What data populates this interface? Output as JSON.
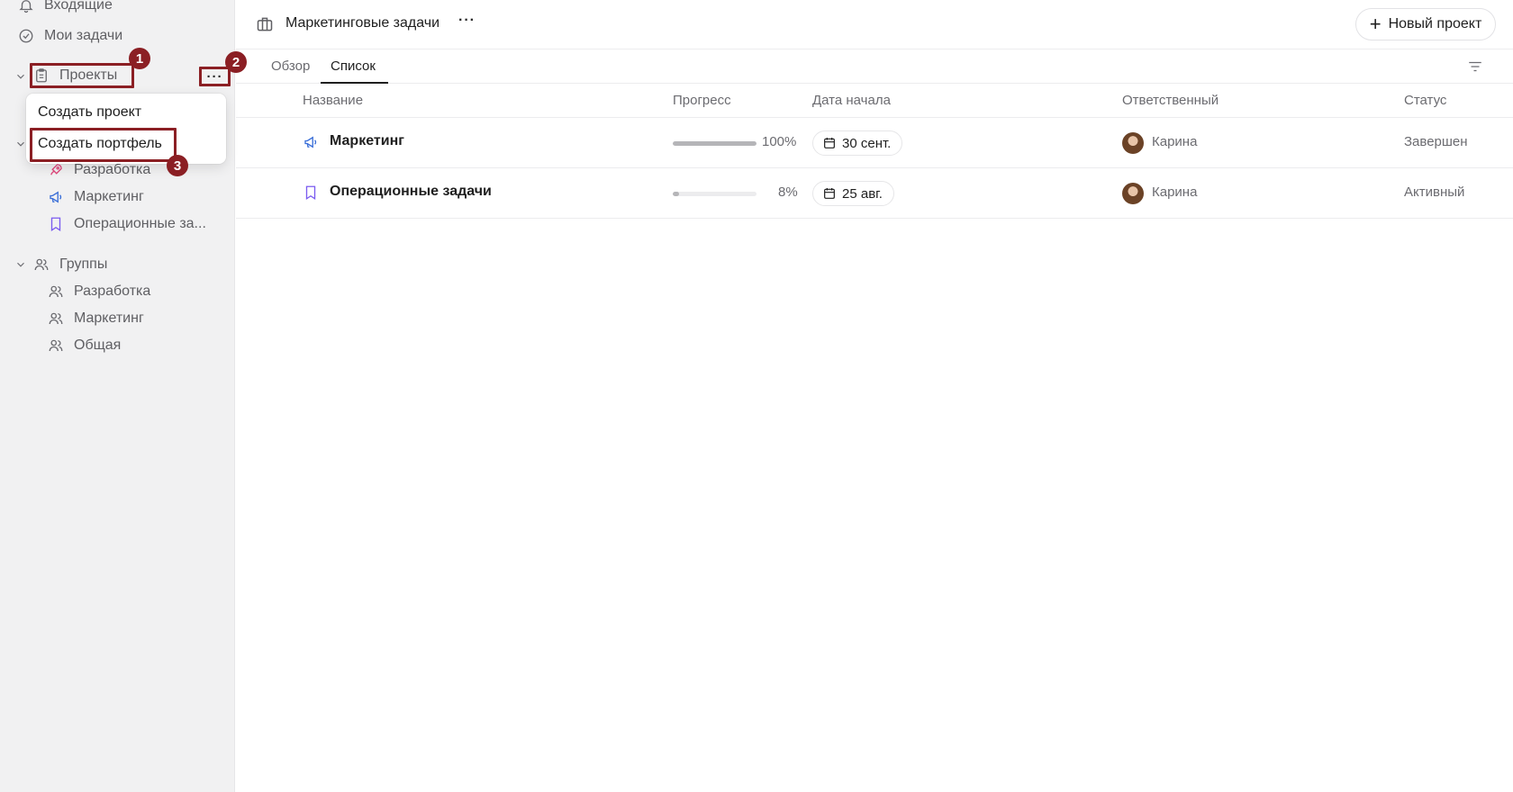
{
  "sidebar": {
    "inbox": "Входящие",
    "my_tasks": "Мои задачи",
    "projects_header": "Проекты",
    "projects_more": "···",
    "menu": {
      "create_project": "Создать проект",
      "create_portfolio": "Создать портфель"
    },
    "projects": [
      {
        "label": "Разработка",
        "icon": "rocket-icon"
      },
      {
        "label": "Маркетинг",
        "icon": "megaphone-icon"
      },
      {
        "label": "Операционные за...",
        "icon": "bookmark-icon"
      }
    ],
    "groups_header": "Группы",
    "groups": [
      {
        "label": "Разработка"
      },
      {
        "label": "Маркетинг"
      },
      {
        "label": "Общая"
      }
    ]
  },
  "annotations": [
    "1",
    "2",
    "3"
  ],
  "header": {
    "title": "Маркетинговые задачи",
    "more": "···",
    "new_project": "Новый проект"
  },
  "tabs": [
    "Обзор",
    "Список"
  ],
  "active_tab": "Список",
  "table": {
    "columns": [
      "Название",
      "Прогресс",
      "Дата начала",
      "Ответственный",
      "Статус"
    ],
    "rows": [
      {
        "name": "Маркетинг",
        "icon": "megaphone-icon",
        "progress": 100,
        "progress_label": "100%",
        "date": "30 сент.",
        "owner": "Карина",
        "status": "Завершен"
      },
      {
        "name": "Операционные задачи",
        "icon": "bookmark-icon",
        "progress": 8,
        "progress_label": "8%",
        "date": "25 авг.",
        "owner": "Карина",
        "status": "Активный"
      }
    ]
  },
  "colors": {
    "annotation": "#8b1f24",
    "marketing_icon": "#3b6fd8",
    "operations_icon": "#7b5cf0",
    "development_icon": "#e0457b"
  }
}
